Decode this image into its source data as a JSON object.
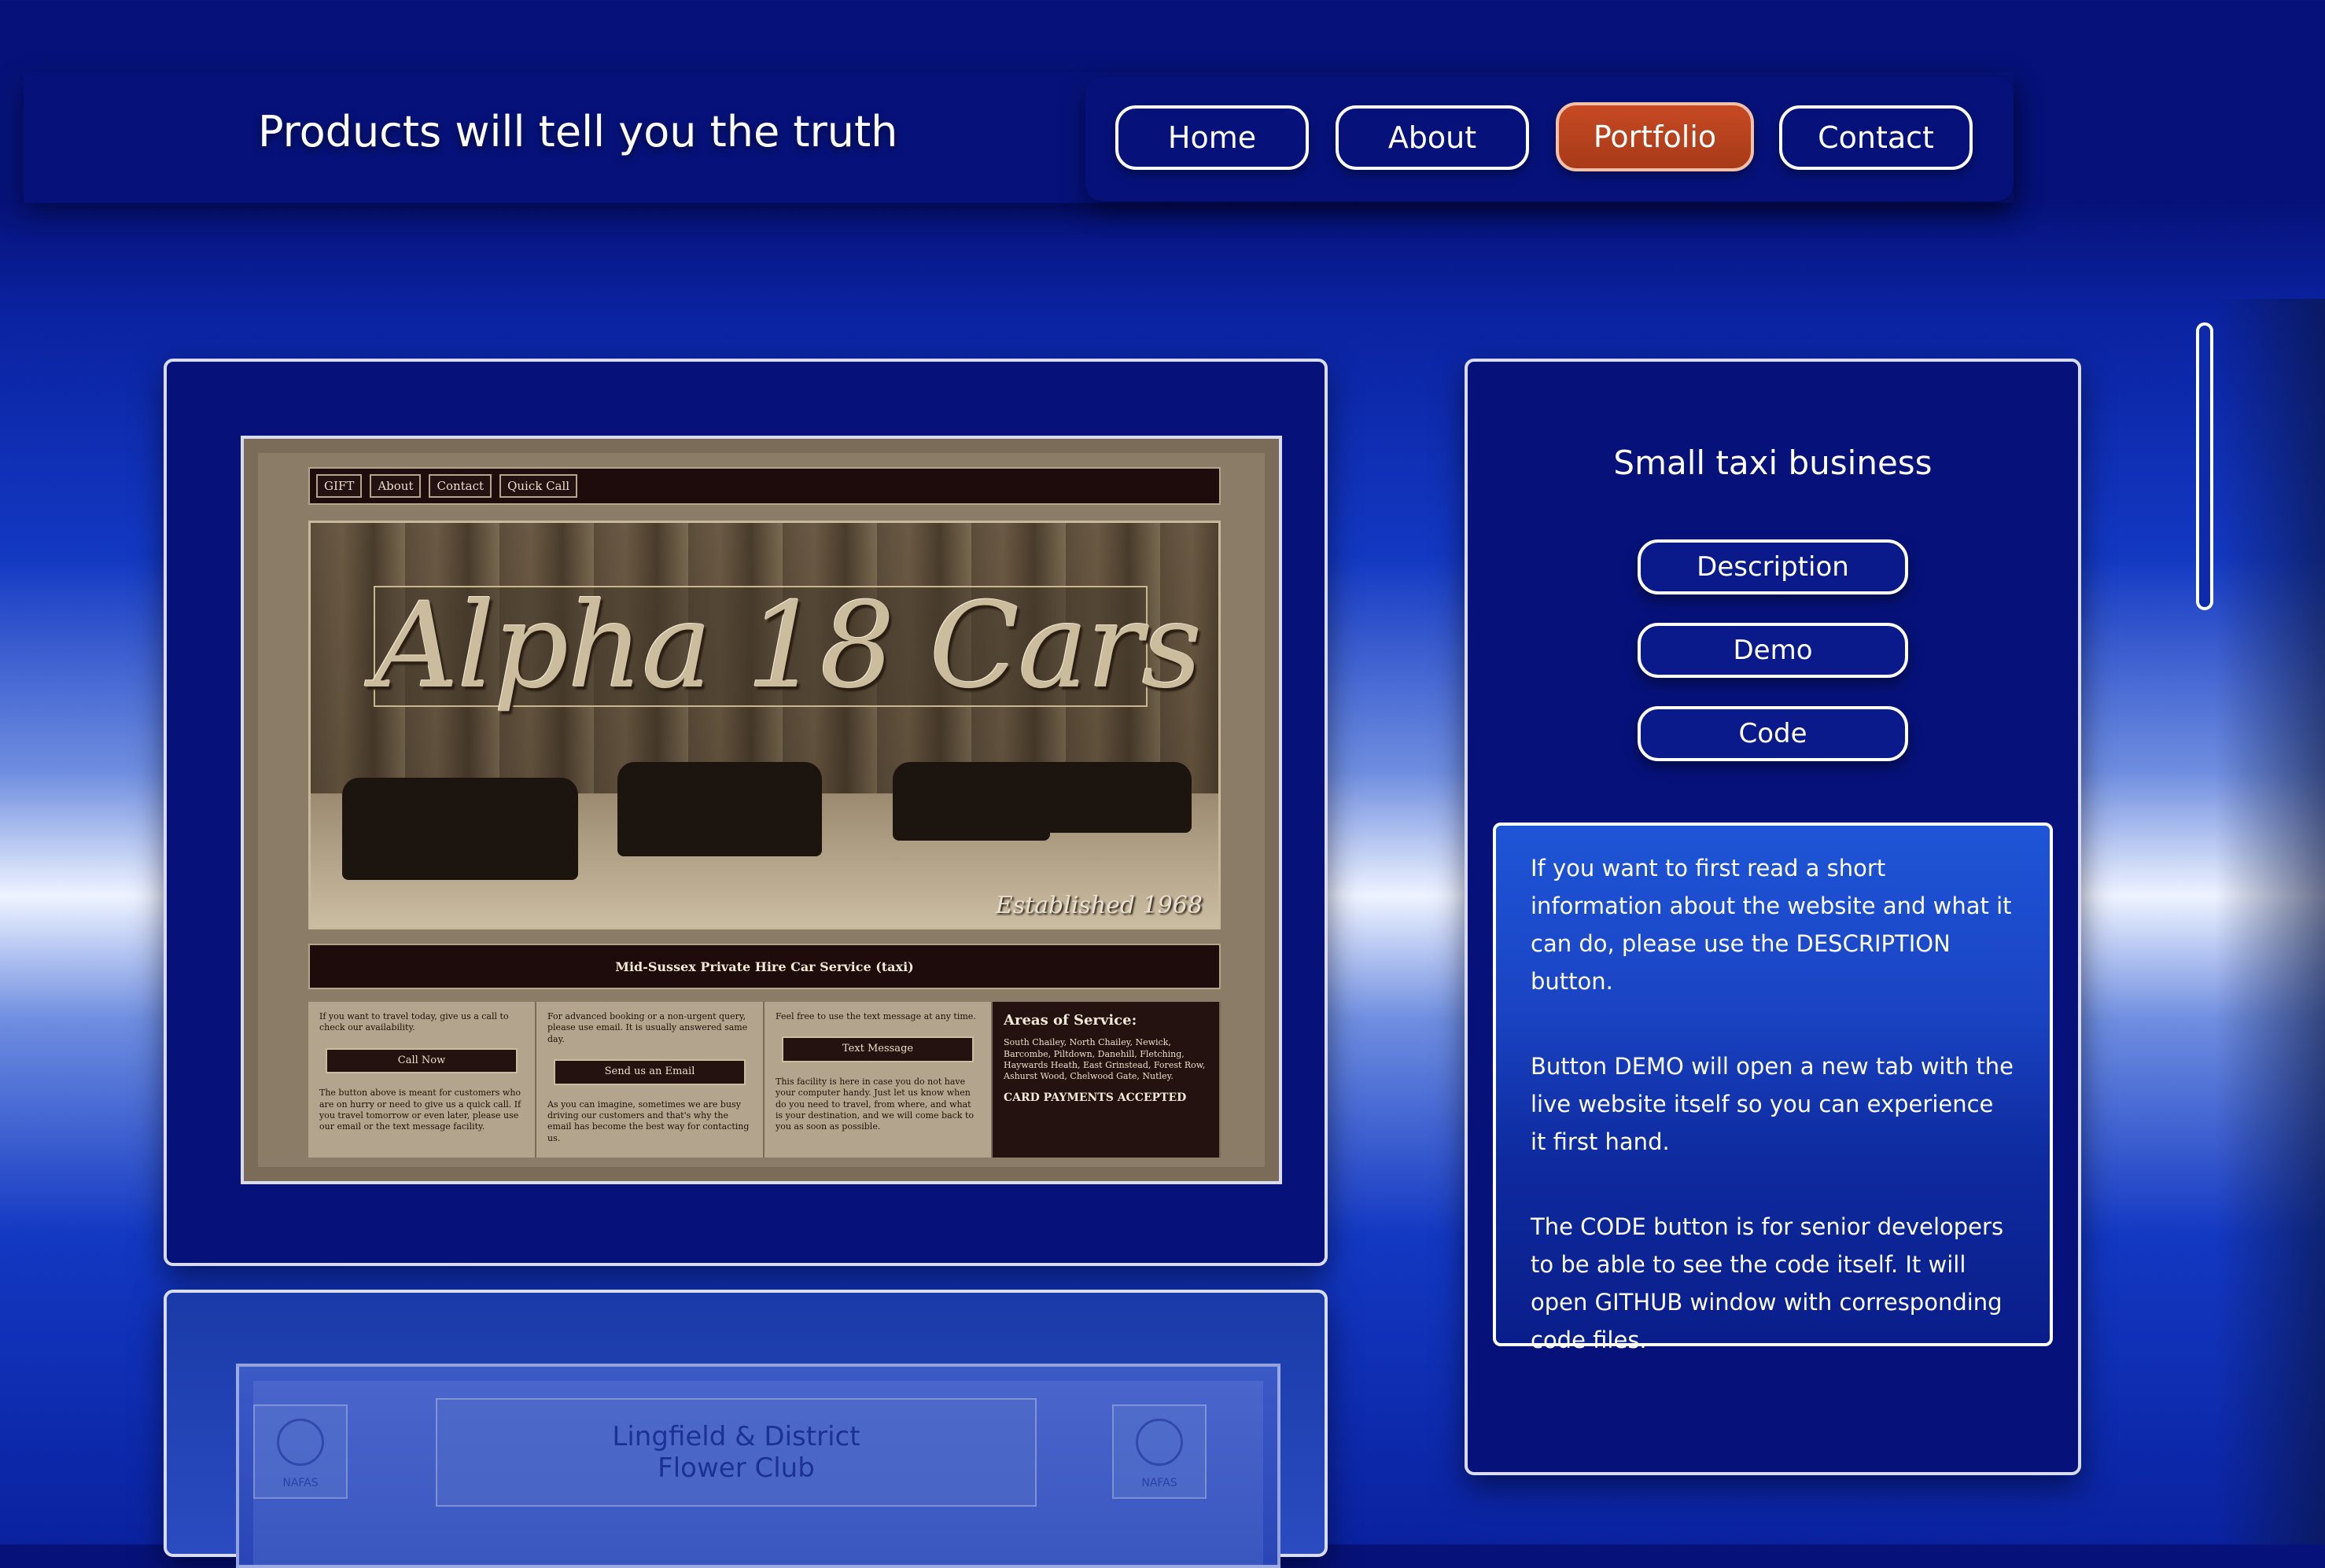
{
  "header": {
    "title": "Products will tell you the truth",
    "nav": [
      {
        "label": "Home",
        "active": false
      },
      {
        "label": "About",
        "active": false
      },
      {
        "label": "Portfolio",
        "active": true
      },
      {
        "label": "Contact",
        "active": false
      }
    ]
  },
  "project": {
    "title": "Small taxi business",
    "buttons": {
      "description": "Description",
      "demo": "Demo",
      "code": "Code"
    },
    "info": [
      "If you want to first read a short information about the website and what it can do, please use the DESCRIPTION button.",
      "Button DEMO will open a new tab with the live website itself so you can experience it first hand.",
      "The CODE button is for senior developers to be able to see the code itself. It will open GITHUB window with corresponding code files."
    ],
    "preview": {
      "nav": [
        "GIFT",
        "About",
        "Contact",
        "Quick Call"
      ],
      "hero_title": "Alpha 18 Cars",
      "hero_subtitle": "Established 1968",
      "banner": "Mid-Sussex Private Hire Car Service (taxi)",
      "col1_text": "If you want to travel today, give us a call to check our availability.",
      "col1_button": "Call Now",
      "col1_note": "The button above is meant for customers who are on hurry or need to give us a quick call. If you travel tomorrow or even later, please use our email or the text message facility.",
      "col2_text": "For advanced booking or a non-urgent query, please use email. It is usually answered same day.",
      "col2_button": "Send us an Email",
      "col2_note": "As you can imagine, sometimes we are busy driving our customers and that's why the email has become the best way for contacting us.",
      "col3_text": "Feel free to use the text message at any time.",
      "col3_button": "Text Message",
      "col3_note": "This facility is here in case you do not have your computer handy. Just let us know when do you need to travel, from where, and what is your destination, and we will come back to you as soon as possible.",
      "areas_title": "Areas of Service:",
      "areas_list": "South Chailey, North Chailey, Newick, Barcombe, Piltdown, Danehill, Fletching, Haywards Heath, East Grinstead, Forest Row, Ashurst Wood, Chelwood Gate, Nutley.",
      "areas_note": "CARD PAYMENTS ACCEPTED"
    }
  },
  "next_project": {
    "title_line1": "Lingfield & District",
    "title_line2": "Flower Club",
    "badge_text": "NAFAS"
  },
  "colors": {
    "nav_bg": "#061279",
    "active_nav": "#c64a24",
    "card_border": "#d9dcf0"
  }
}
